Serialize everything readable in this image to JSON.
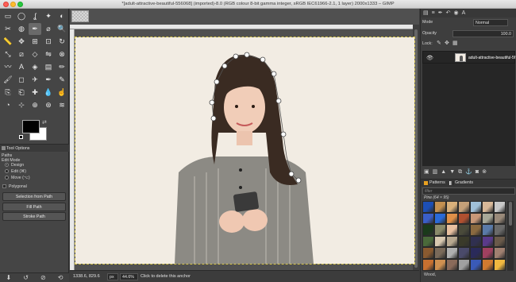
{
  "window": {
    "title": "*[adult-attractive-beautiful-556068] (imported)-8.0 (RGB colour 8-bit gamma integer, sRGB IEC61966-2.1, 1 layer) 2000x1333 – GIMP"
  },
  "toolbox": {
    "tools": [
      "rect-select-icon",
      "ellipse-select-icon",
      "free-select-icon",
      "fuzzy-select-icon",
      "color-select-icon",
      "scissors-icon",
      "foreground-select-icon",
      "paths-icon",
      "color-picker-icon",
      "zoom-icon",
      "measure-icon",
      "move-icon",
      "align-icon",
      "crop-icon",
      "rotate-icon",
      "scale-icon",
      "shear-icon",
      "perspective-icon",
      "flip-icon",
      "cage-icon",
      "warp-icon",
      "text-icon",
      "bucket-fill-icon",
      "blend-icon",
      "pencil-icon",
      "paintbrush-icon",
      "eraser-icon",
      "airbrush-icon",
      "ink-icon",
      "mypaint-icon",
      "clone-icon",
      "perspective-clone-icon",
      "heal-icon",
      "blur-icon",
      "smudge-icon",
      "dodge-burn-icon",
      "handle-transform-icon",
      "unified-transform-icon",
      "seamless-clone-icon",
      "warp-transform-icon"
    ],
    "tool_glyphs": [
      "▭",
      "◯",
      "ʆ",
      "✦",
      "◐",
      "✂",
      "◍",
      "✒",
      "⌀",
      "🔍",
      "📏",
      "✥",
      "⊞",
      "⊡",
      "↻",
      "⤡",
      "⧄",
      "◇",
      "⇋",
      "⊗",
      "〰",
      "A",
      "◈",
      "▤",
      "✏",
      "🖌",
      "◻",
      "✈",
      "✒",
      "✎",
      "⎘",
      "⎗",
      "✚",
      "💧",
      "☝",
      "◔",
      "⊹",
      "⊕",
      "⊛",
      "≋"
    ],
    "active_tool_index": 7,
    "fg_color": "#000000",
    "bg_color": "#ffffff",
    "options_tab_label": "Tool Options",
    "tool_name": "Paths",
    "edit_mode_label": "Edit Mode",
    "modes": [
      "Design",
      "Edit (⌘)",
      "Move (⌥)"
    ],
    "selected_mode_index": 0,
    "polygonal_label": "Polygonal",
    "buttons": [
      "Selection from Path",
      "Fill Path",
      "Stroke Path"
    ]
  },
  "status": {
    "coords": "1338.6, 829.6",
    "unit": "px",
    "zoom": "44.6%",
    "message": "Click to delete this anchor"
  },
  "layers": {
    "mode_label": "Mode",
    "mode_value": "Normal",
    "opacity_label": "Opacity",
    "opacity_value": "100.0",
    "lock_label": "Lock:",
    "layer_name": "adult-attractive-beautiful-5f"
  },
  "patterns": {
    "tab_patterns": "Patterns",
    "tab_gradients": "Gradients",
    "filter_placeholder": "filter",
    "current_pattern": "Pine (64 × 95)",
    "footer_label": "Wood,",
    "colors": [
      "#1d4fb5",
      "#c49050",
      "#d9b07a",
      "#c4a078",
      "#a0c0d8",
      "#d8b898",
      "#c8c8c8",
      "#3a5ec8",
      "#2a6ad8",
      "#e09048",
      "#b05030",
      "#c89878",
      "#a8a898",
      "#9a8a7a",
      "#1a3a1a",
      "#8a8a6a",
      "#e8c0a0",
      "#4a4a3a",
      "#8a6a40",
      "#5a7aa8",
      "#6a6a6a",
      "#4a6a3a",
      "#d8c8b0",
      "#b8a890",
      "#3a3a2a",
      "#303050",
      "#5a3a8a",
      "#6a5a4a",
      "#8a5a30",
      "#7a6a5a",
      "#b0b0b0",
      "#4a4a6a",
      "#2a2a5a",
      "#a04060",
      "#a08070",
      "#c87030",
      "#d09050",
      "#8a6a5a",
      "#a0a0a0",
      "#3a5ab8",
      "#d07a30",
      "#f0b840"
    ]
  }
}
